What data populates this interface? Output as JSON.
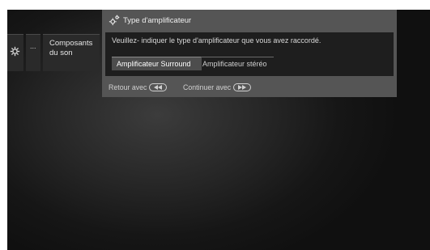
{
  "breadcrumb": {
    "items": [
      {
        "icon": "gear-icon"
      },
      {
        "label": "..."
      },
      {
        "label": "Composants du son"
      }
    ]
  },
  "dialog": {
    "title_icon": "gears-icon",
    "title": "Type d'amplificateur",
    "prompt": "Veuillez- indiquer le type d'amplificateur que vous avez raccordé.",
    "options": [
      {
        "label": "Amplificateur Surround",
        "selected": true
      },
      {
        "label": "Amplificateur stéréo",
        "selected": false
      }
    ]
  },
  "footer": {
    "back_label": "Retour avec",
    "back_icon": "rewind-button-icon",
    "continue_label": "Continuer avec",
    "continue_icon": "fast-forward-button-icon"
  }
}
